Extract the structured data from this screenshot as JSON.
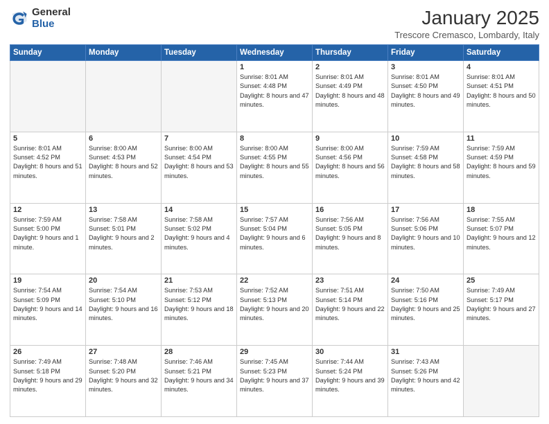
{
  "logo": {
    "general": "General",
    "blue": "Blue"
  },
  "header": {
    "month": "January 2025",
    "location": "Trescore Cremasco, Lombardy, Italy"
  },
  "days_of_week": [
    "Sunday",
    "Monday",
    "Tuesday",
    "Wednesday",
    "Thursday",
    "Friday",
    "Saturday"
  ],
  "weeks": [
    [
      {
        "day": "",
        "info": ""
      },
      {
        "day": "",
        "info": ""
      },
      {
        "day": "",
        "info": ""
      },
      {
        "day": "1",
        "info": "Sunrise: 8:01 AM\nSunset: 4:48 PM\nDaylight: 8 hours and 47 minutes."
      },
      {
        "day": "2",
        "info": "Sunrise: 8:01 AM\nSunset: 4:49 PM\nDaylight: 8 hours and 48 minutes."
      },
      {
        "day": "3",
        "info": "Sunrise: 8:01 AM\nSunset: 4:50 PM\nDaylight: 8 hours and 49 minutes."
      },
      {
        "day": "4",
        "info": "Sunrise: 8:01 AM\nSunset: 4:51 PM\nDaylight: 8 hours and 50 minutes."
      }
    ],
    [
      {
        "day": "5",
        "info": "Sunrise: 8:01 AM\nSunset: 4:52 PM\nDaylight: 8 hours and 51 minutes."
      },
      {
        "day": "6",
        "info": "Sunrise: 8:00 AM\nSunset: 4:53 PM\nDaylight: 8 hours and 52 minutes."
      },
      {
        "day": "7",
        "info": "Sunrise: 8:00 AM\nSunset: 4:54 PM\nDaylight: 8 hours and 53 minutes."
      },
      {
        "day": "8",
        "info": "Sunrise: 8:00 AM\nSunset: 4:55 PM\nDaylight: 8 hours and 55 minutes."
      },
      {
        "day": "9",
        "info": "Sunrise: 8:00 AM\nSunset: 4:56 PM\nDaylight: 8 hours and 56 minutes."
      },
      {
        "day": "10",
        "info": "Sunrise: 7:59 AM\nSunset: 4:58 PM\nDaylight: 8 hours and 58 minutes."
      },
      {
        "day": "11",
        "info": "Sunrise: 7:59 AM\nSunset: 4:59 PM\nDaylight: 8 hours and 59 minutes."
      }
    ],
    [
      {
        "day": "12",
        "info": "Sunrise: 7:59 AM\nSunset: 5:00 PM\nDaylight: 9 hours and 1 minute."
      },
      {
        "day": "13",
        "info": "Sunrise: 7:58 AM\nSunset: 5:01 PM\nDaylight: 9 hours and 2 minutes."
      },
      {
        "day": "14",
        "info": "Sunrise: 7:58 AM\nSunset: 5:02 PM\nDaylight: 9 hours and 4 minutes."
      },
      {
        "day": "15",
        "info": "Sunrise: 7:57 AM\nSunset: 5:04 PM\nDaylight: 9 hours and 6 minutes."
      },
      {
        "day": "16",
        "info": "Sunrise: 7:56 AM\nSunset: 5:05 PM\nDaylight: 9 hours and 8 minutes."
      },
      {
        "day": "17",
        "info": "Sunrise: 7:56 AM\nSunset: 5:06 PM\nDaylight: 9 hours and 10 minutes."
      },
      {
        "day": "18",
        "info": "Sunrise: 7:55 AM\nSunset: 5:07 PM\nDaylight: 9 hours and 12 minutes."
      }
    ],
    [
      {
        "day": "19",
        "info": "Sunrise: 7:54 AM\nSunset: 5:09 PM\nDaylight: 9 hours and 14 minutes."
      },
      {
        "day": "20",
        "info": "Sunrise: 7:54 AM\nSunset: 5:10 PM\nDaylight: 9 hours and 16 minutes."
      },
      {
        "day": "21",
        "info": "Sunrise: 7:53 AM\nSunset: 5:12 PM\nDaylight: 9 hours and 18 minutes."
      },
      {
        "day": "22",
        "info": "Sunrise: 7:52 AM\nSunset: 5:13 PM\nDaylight: 9 hours and 20 minutes."
      },
      {
        "day": "23",
        "info": "Sunrise: 7:51 AM\nSunset: 5:14 PM\nDaylight: 9 hours and 22 minutes."
      },
      {
        "day": "24",
        "info": "Sunrise: 7:50 AM\nSunset: 5:16 PM\nDaylight: 9 hours and 25 minutes."
      },
      {
        "day": "25",
        "info": "Sunrise: 7:49 AM\nSunset: 5:17 PM\nDaylight: 9 hours and 27 minutes."
      }
    ],
    [
      {
        "day": "26",
        "info": "Sunrise: 7:49 AM\nSunset: 5:18 PM\nDaylight: 9 hours and 29 minutes."
      },
      {
        "day": "27",
        "info": "Sunrise: 7:48 AM\nSunset: 5:20 PM\nDaylight: 9 hours and 32 minutes."
      },
      {
        "day": "28",
        "info": "Sunrise: 7:46 AM\nSunset: 5:21 PM\nDaylight: 9 hours and 34 minutes."
      },
      {
        "day": "29",
        "info": "Sunrise: 7:45 AM\nSunset: 5:23 PM\nDaylight: 9 hours and 37 minutes."
      },
      {
        "day": "30",
        "info": "Sunrise: 7:44 AM\nSunset: 5:24 PM\nDaylight: 9 hours and 39 minutes."
      },
      {
        "day": "31",
        "info": "Sunrise: 7:43 AM\nSunset: 5:26 PM\nDaylight: 9 hours and 42 minutes."
      },
      {
        "day": "",
        "info": ""
      }
    ]
  ]
}
